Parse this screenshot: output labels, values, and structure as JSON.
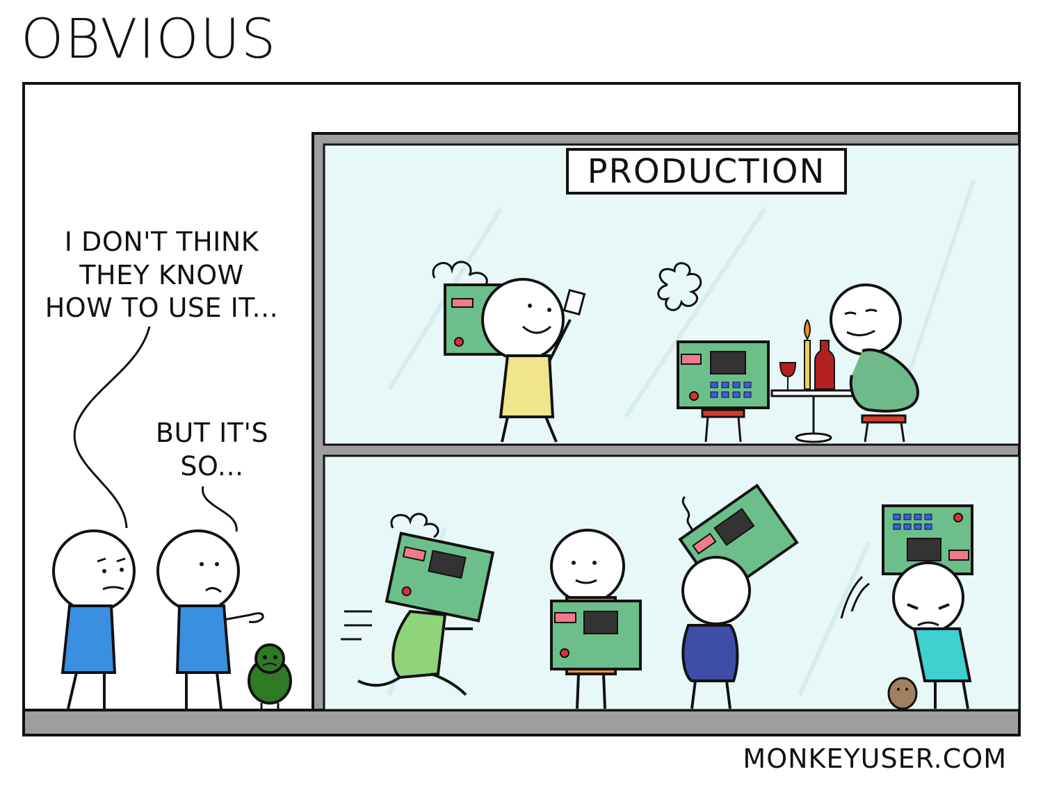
{
  "comic": {
    "title": "OBVIOUS",
    "sign": "PRODUCTION",
    "speech_left": [
      "I DON'T THINK",
      "THEY KNOW",
      "HOW TO USE IT..."
    ],
    "speech_right": [
      "BUT IT'S",
      "SO..."
    ],
    "signature": "MONKEYUSER.COM"
  },
  "colors": {
    "glass": "#e8f7f7",
    "wall": "#9e9e9e",
    "device": "#6cbf8a",
    "shirt_blue": "#3a8fe0",
    "shirt_yellow": "#efe58a",
    "shirt_green": "#6fb98a",
    "shirt_lime": "#8fd37a",
    "shirt_orange": "#f0a020",
    "shirt_navy": "#3e4ea8",
    "shirt_cyan": "#3fd0d0",
    "bug": "#2f7a24"
  }
}
